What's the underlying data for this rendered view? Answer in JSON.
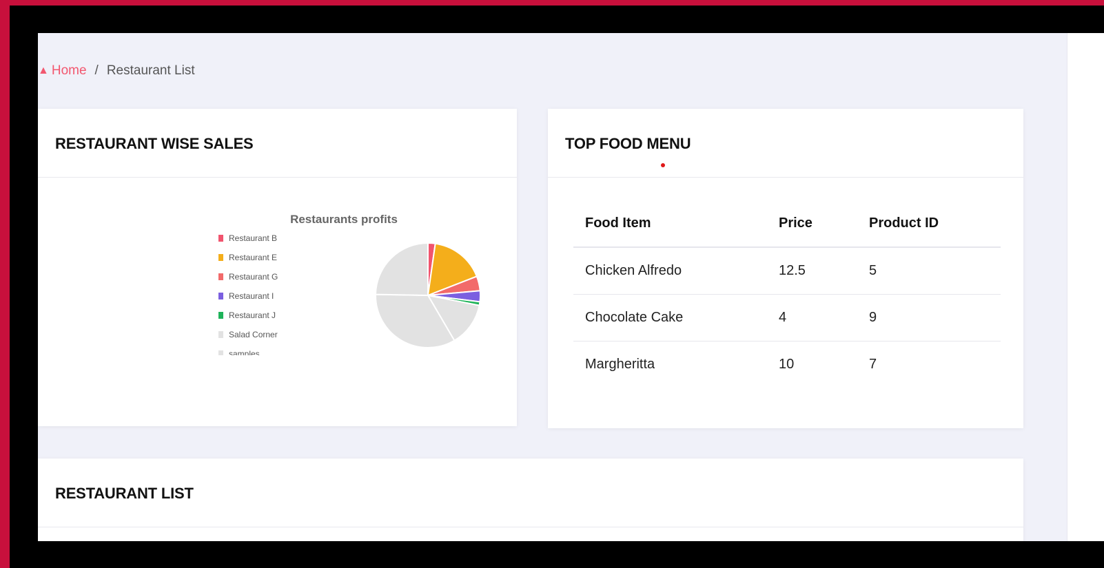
{
  "breadcrumb": {
    "home": "Home",
    "separator": "/",
    "current": "Restaurant List"
  },
  "cards": {
    "sales_title": "RESTAURANT WISE SALES",
    "menu_title": "TOP FOOD MENU",
    "list_title": "RESTAURANT LIST"
  },
  "food_table": {
    "headers": [
      "Food Item",
      "Price",
      "Product ID"
    ],
    "rows": [
      [
        "Chicken Alfredo",
        "12.5",
        "5"
      ],
      [
        "Chocolate Cake",
        "4",
        "9"
      ],
      [
        "Margheritta",
        "10",
        "7"
      ]
    ]
  },
  "chart_data": {
    "type": "pie",
    "title": "Restaurants profits",
    "legend_placement": "left",
    "categories": [
      "Restaurant B",
      "Restaurant E",
      "Restaurant G",
      "Restaurant I",
      "Restaurant J",
      "Salad Corner",
      "samples"
    ],
    "values": [
      2,
      15,
      4,
      3,
      1,
      12,
      30,
      22
    ],
    "slice_labels": [
      "Restaurant B",
      "Restaurant E",
      "Restaurant G",
      "Restaurant I",
      "Restaurant J",
      "Salad Corner",
      "samples",
      "(unlabeled)"
    ],
    "colors": [
      "#f1546e",
      "#f4ae1b",
      "#f26a6a",
      "#7b5fe0",
      "#1fb35a",
      "#e2e2e2",
      "#e2e2e2",
      "#e2e2e2"
    ]
  }
}
